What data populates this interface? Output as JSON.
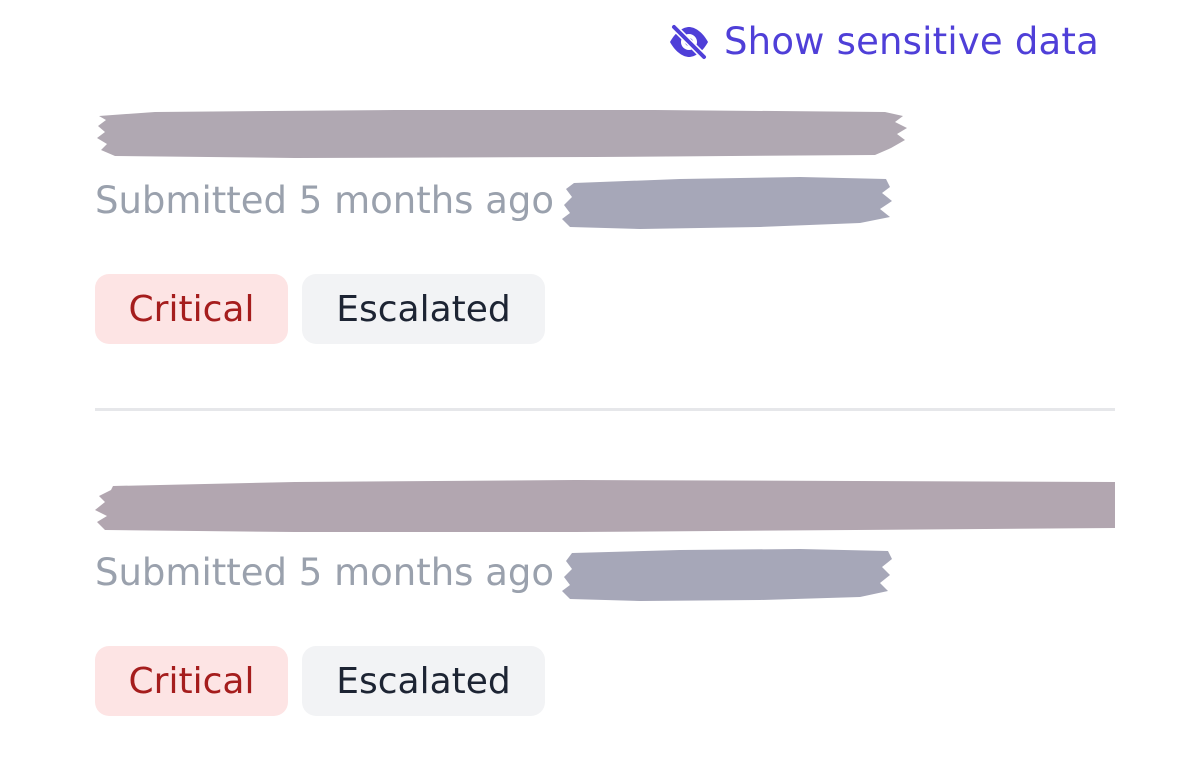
{
  "header": {
    "toggle_label": "Show sensitive data",
    "toggle_icon": "eye-slash-icon",
    "accent_color": "#4f3fd8"
  },
  "reports": [
    {
      "title": "",
      "submitted_text": "Submitted 5 months ago",
      "submitter": "",
      "severity": "Critical",
      "status": "Escalated"
    },
    {
      "title": "",
      "submitted_text": "Submitted 5 months ago",
      "submitter": "",
      "severity": "Critical",
      "status": "Escalated"
    }
  ],
  "colors": {
    "critical_bg": "#fde4e4",
    "critical_text": "#a51d1d",
    "escalated_bg": "#f2f3f5",
    "escalated_text": "#1d2433",
    "redaction_title": "#b0a8b2",
    "redaction_user": "#a6a7b8"
  }
}
